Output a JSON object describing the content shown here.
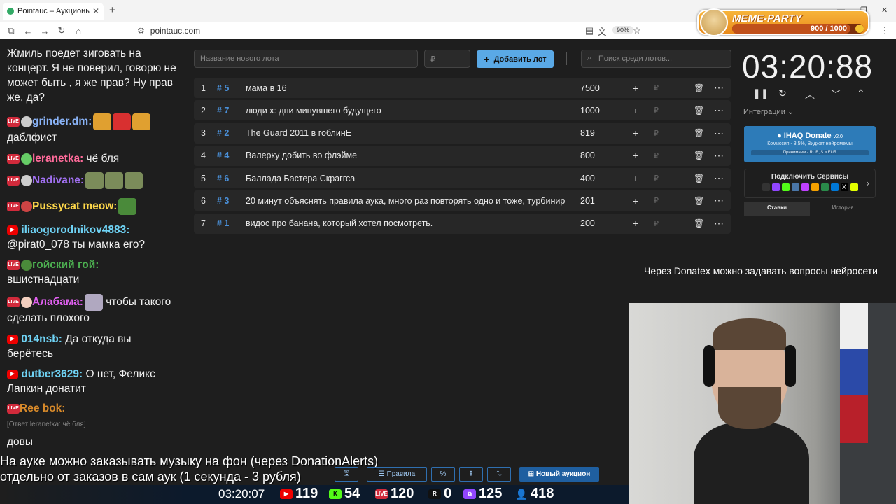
{
  "browser": {
    "tab_title": "Pointauc – Аукционы, лотереи",
    "url": "pointauc.com",
    "zoom": "90%"
  },
  "meme_party": {
    "title": "MEME-PARTY",
    "count": "900 / 1000",
    "progress": 0.9
  },
  "chat": [
    {
      "type": "text",
      "text": "Жмиль поедет зиговать на концерт. Я не поверил, говорю не может быть , я  же прав? Ну прав же, да?"
    },
    {
      "type": "msg",
      "platform": "LIVE",
      "nick": "grinder.dm:",
      "color": "#8ab4f8",
      "text": "даблфист"
    },
    {
      "type": "msg",
      "platform": "LIVE",
      "nick": "leranetka:",
      "color": "#ff6b9a",
      "text": "чё бля"
    },
    {
      "type": "msg",
      "platform": "LIVE",
      "nick": "Nadivane:",
      "color": "#a070f0",
      "text": ""
    },
    {
      "type": "msg",
      "platform": "LIVE",
      "nick": "Pussycat meow:",
      "color": "#ffd84a",
      "text": ""
    },
    {
      "type": "msg",
      "platform": "YT",
      "nick": "iliaogorodnikov4883:",
      "color": "#6fd3f5",
      "text": "@pirat0_078 ты мамка его?"
    },
    {
      "type": "msg",
      "platform": "LIVE",
      "nick": "гойский гой:",
      "color": "#4caf50",
      "text": "вшистнадцати"
    },
    {
      "type": "msg",
      "platform": "LIVE",
      "nick": "Алабама:",
      "color": "#e060f0",
      "text": "чтобы такого сделать плохого"
    },
    {
      "type": "msg",
      "platform": "YT",
      "nick": "014nsb:",
      "color": "#6fd3f5",
      "text": "Да откуда вы берётесь"
    },
    {
      "type": "msg",
      "platform": "YT",
      "nick": "dutber3629:",
      "color": "#6fd3f5",
      "text": "О нет, Феликс Лапкин донатит"
    },
    {
      "type": "msg",
      "platform": "LIVE",
      "nick": "Ree bok:",
      "color": "#d88a2a",
      "text": ""
    },
    {
      "type": "quote",
      "text": "[Ответ leranetka: чё бля]"
    },
    {
      "type": "text",
      "text": "довы"
    }
  ],
  "toolbar": {
    "name_placeholder": "Название нового лота",
    "amount_placeholder": "₽",
    "add_label": "Добавить лот",
    "search_placeholder": "Поиск среди лотов..."
  },
  "lots": [
    {
      "n": "1",
      "id": "# 5",
      "name": "мама в 16",
      "amount": "7500"
    },
    {
      "n": "2",
      "id": "# 7",
      "name": "люди х: дни минувшего будущего",
      "amount": "1000"
    },
    {
      "n": "3",
      "id": "# 2",
      "name": "The Guard 2011 в гоблинЕ",
      "amount": "819"
    },
    {
      "n": "4",
      "id": "# 4",
      "name": "Валерку добить во флэйме",
      "amount": "800"
    },
    {
      "n": "5",
      "id": "# 6",
      "name": "Баллада Бастера Скраггса",
      "amount": "400"
    },
    {
      "n": "6",
      "id": "# 3",
      "name": "20 минут объяснять правила аука, много раз повторять одно и тоже, турбинир",
      "amount": "201"
    },
    {
      "n": "7",
      "id": "# 1",
      "name": "видос про банана, который хотел посмотреть.",
      "amount": "200"
    }
  ],
  "timer": "03:20:88",
  "integrations_label": "Интеграции",
  "donate": {
    "title": "IHAQ Donate",
    "version": "v2.0",
    "sub": "Комиссия - 3,5%, Виджет нейромемы",
    "pay": "Принимаем - RUB, $ и EUR"
  },
  "connect_label": "Подключить Сервисы",
  "side_tabs": {
    "bets": "Ставки",
    "history": "История"
  },
  "ticker": "Через Donatex можно задавать вопросы нейросети",
  "notice": [
    "На ауке можно заказывать музыку на фон (через DonationAlerts)",
    "отдельно от заказов в сам аук (1 секунда - 3 рубля)"
  ],
  "bottom_bar": {
    "rules": "Правила",
    "percent": "%",
    "new_auction": "Новый аукцион"
  },
  "stats": {
    "time": "03:20:07",
    "youtube": "119",
    "kick": "54",
    "live": "120",
    "r": "0",
    "twitch": "125",
    "viewers": "418"
  }
}
